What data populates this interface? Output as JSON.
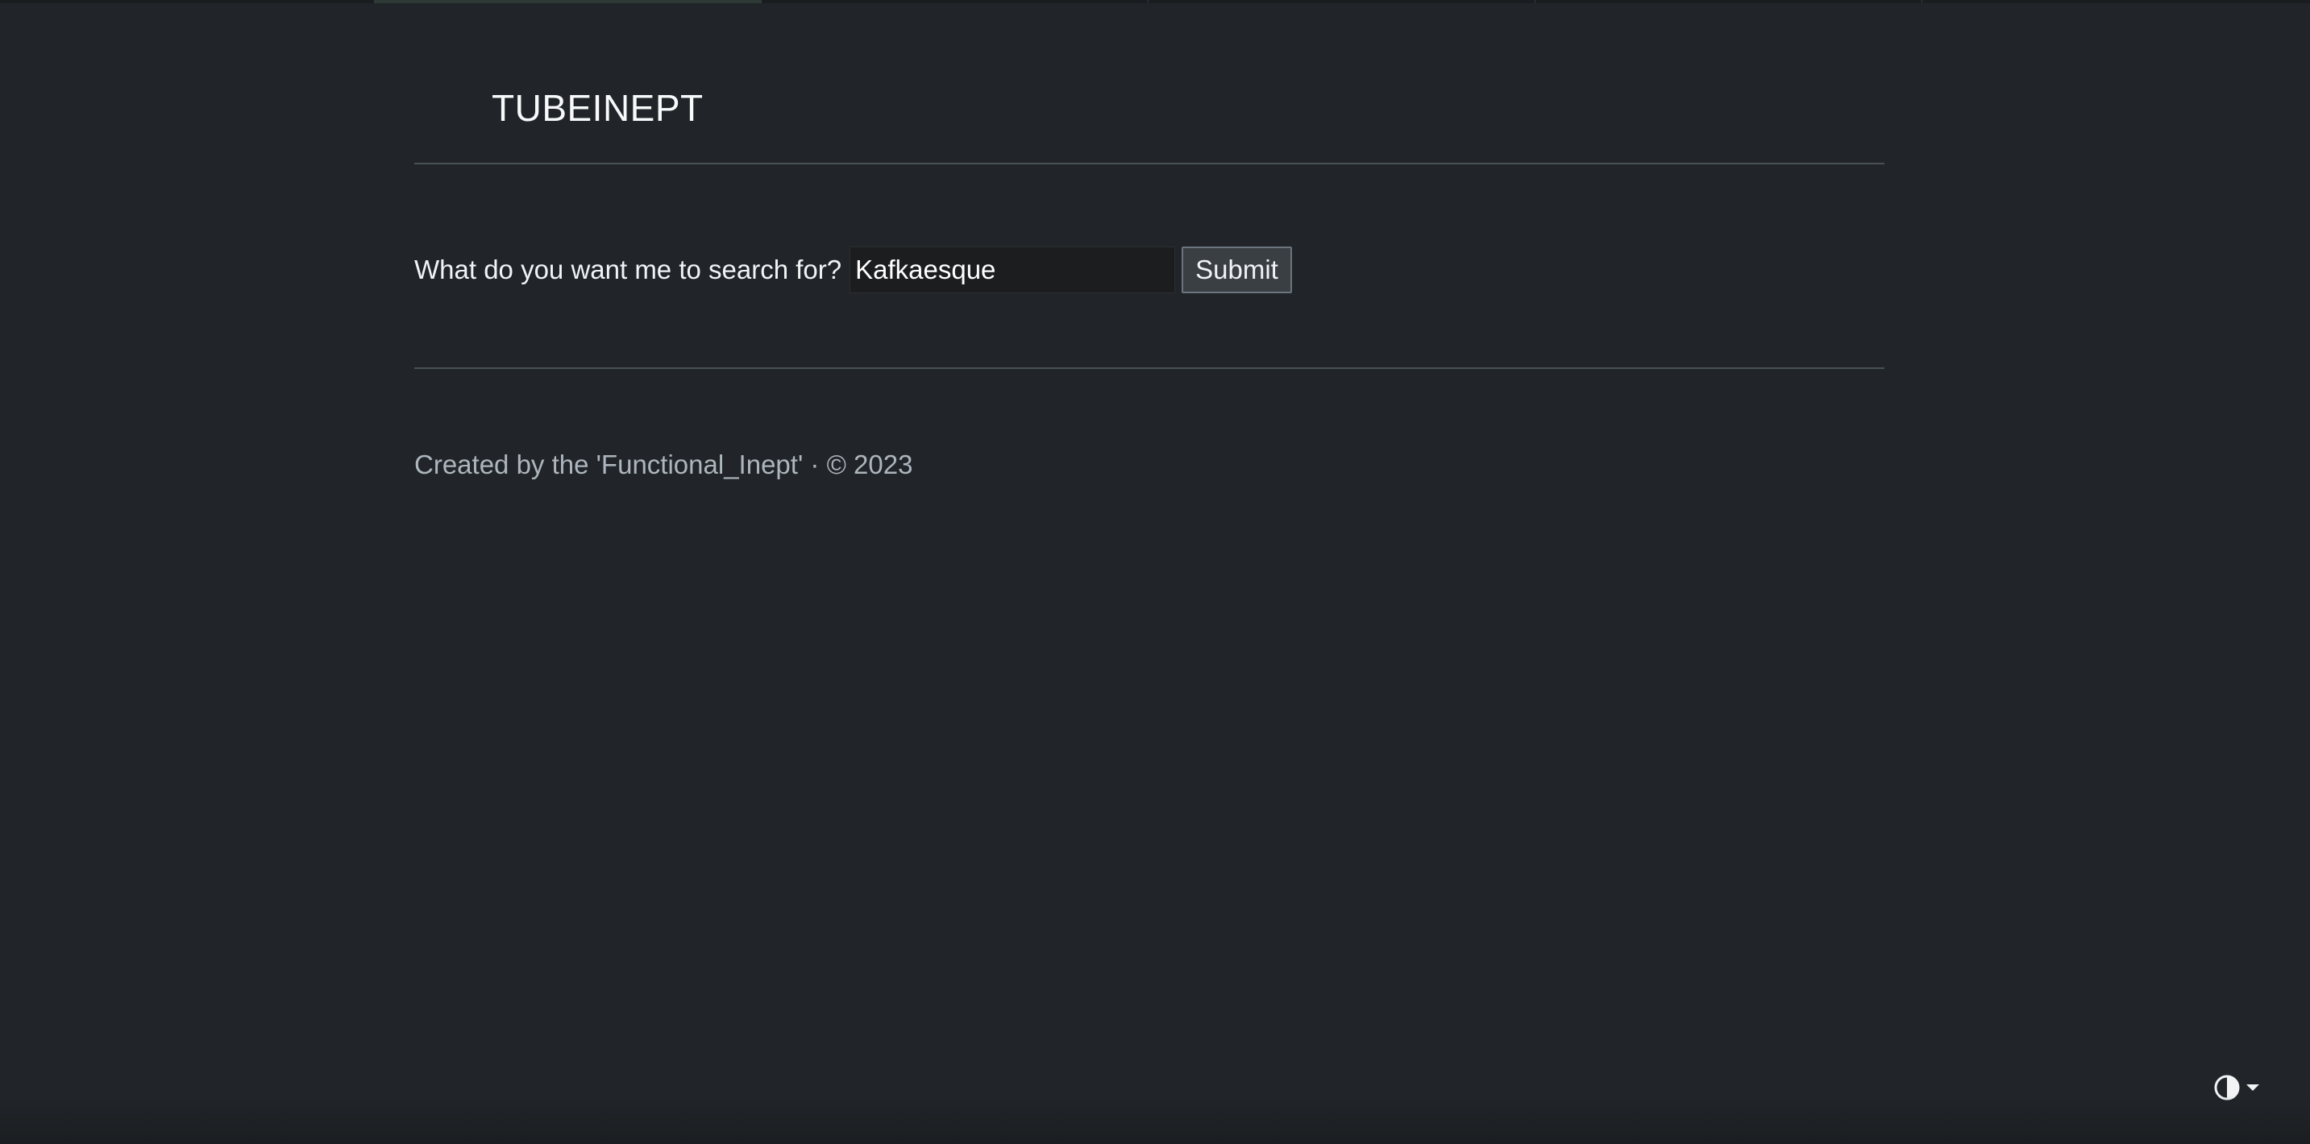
{
  "header": {
    "brand": "TUBEINEPT"
  },
  "search": {
    "label": "What do you want me to search for?",
    "value": "Kafkaesque",
    "placeholder": "",
    "submit_label": "Submit"
  },
  "footer": {
    "text": "Created by the 'Functional_Inept' · © 2023"
  },
  "theme_toggle": {
    "icon": "circle-half-icon",
    "caret_icon": "caret-down-icon"
  },
  "colors": {
    "background": "#212529",
    "text": "#dee2e6",
    "muted": "#adb5bd",
    "divider": "#495057",
    "button": "#3a3f44"
  }
}
